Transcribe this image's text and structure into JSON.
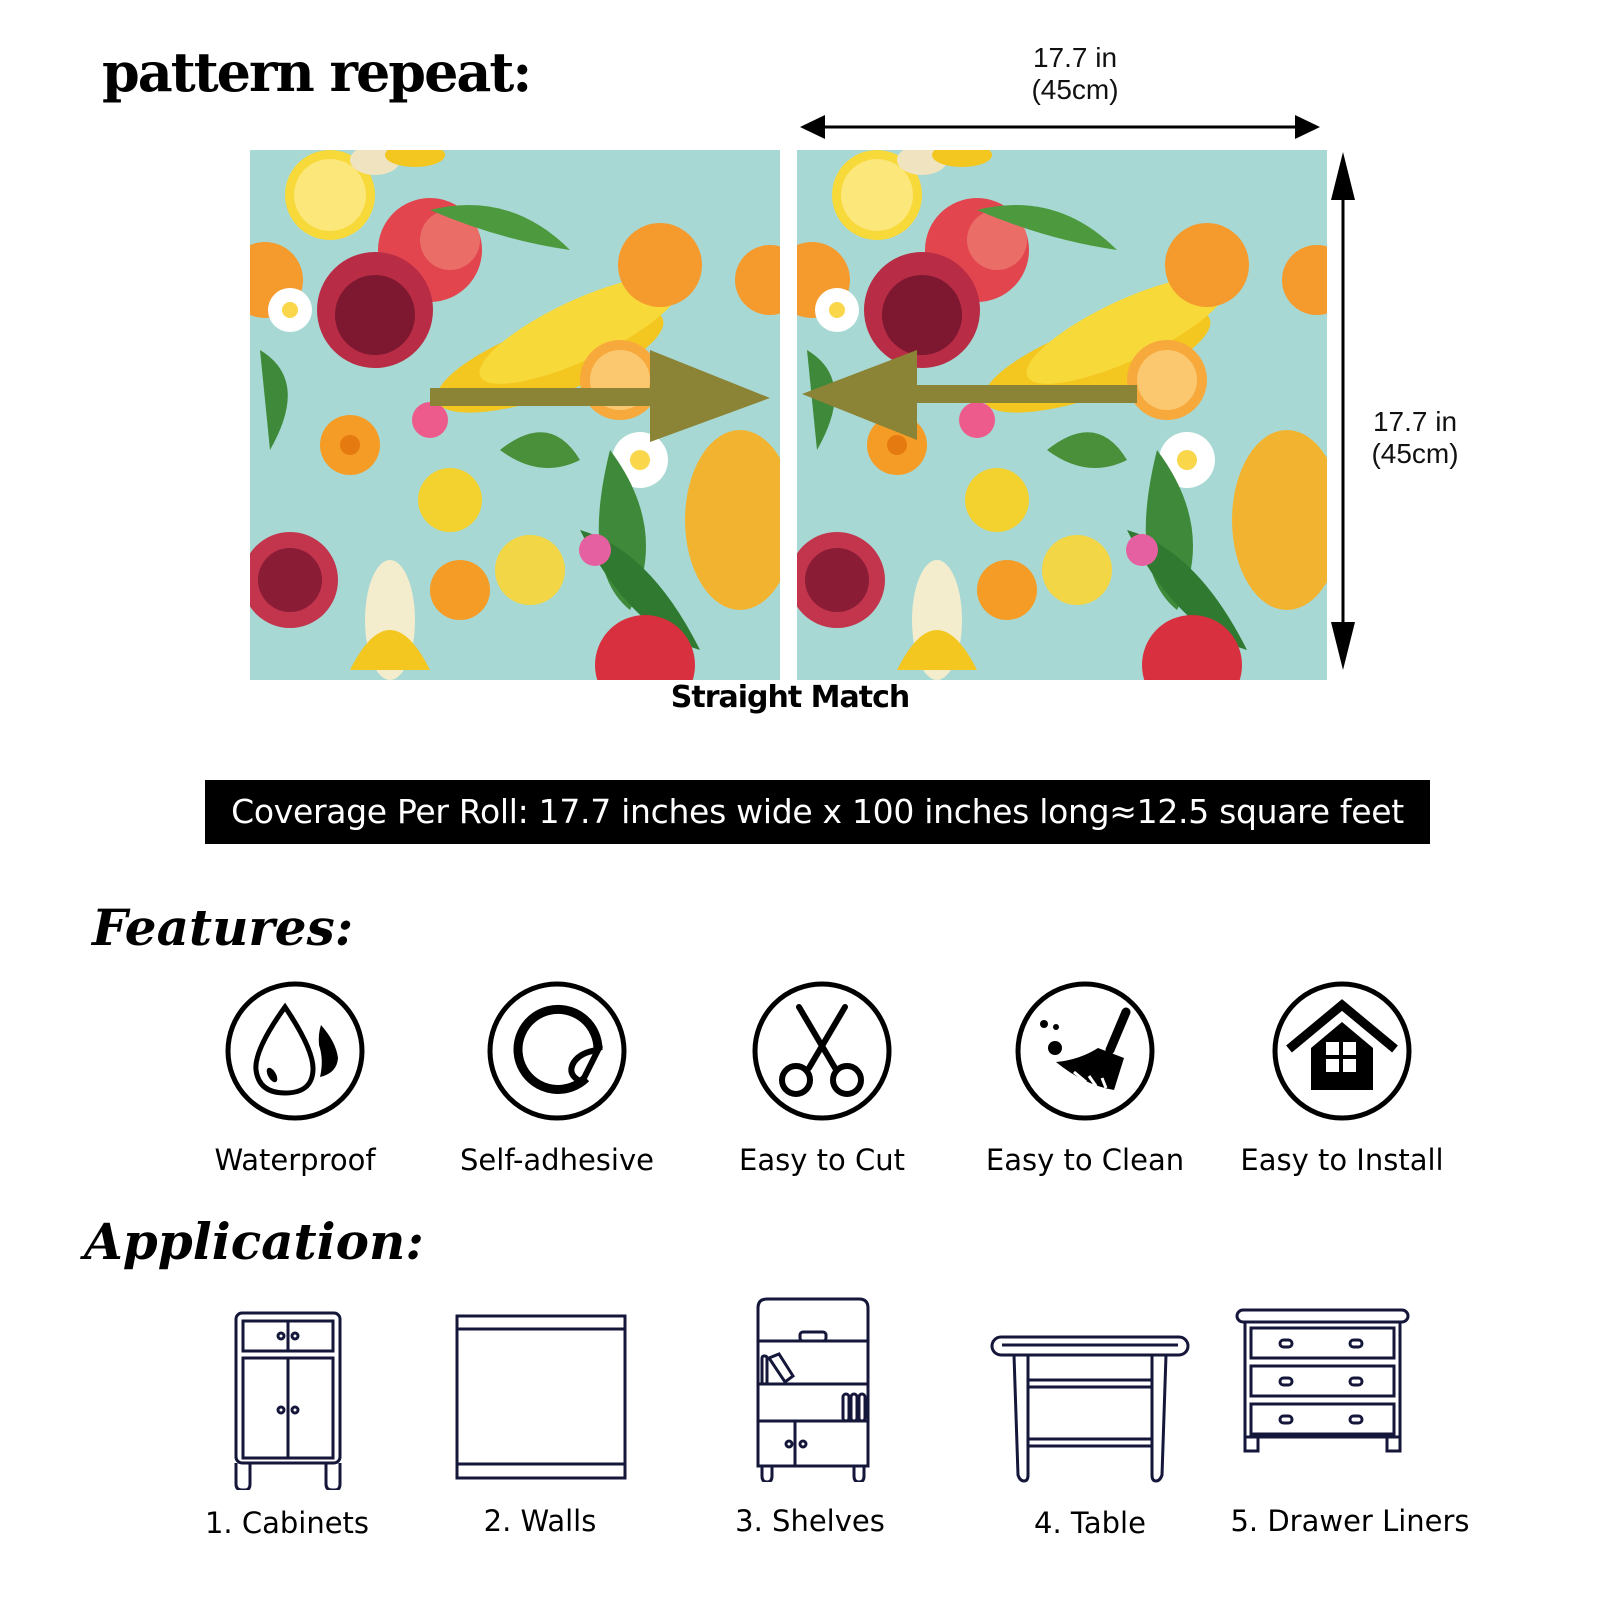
{
  "header": {
    "title": "pattern repeat:"
  },
  "dimensions": {
    "width_in": "17.7 in",
    "width_cm": "(45cm)",
    "height_in": "17.7 in",
    "height_cm": "(45cm)"
  },
  "pattern": {
    "background_color": "#a8d8d3",
    "arrow_color": "#8b8436",
    "match_caption": "Straight Match"
  },
  "coverage": {
    "text": "Coverage Per Roll: 17.7 inches wide x 100 inches long≈12.5 square feet"
  },
  "features": {
    "heading": "Features:",
    "items": [
      {
        "label": "Waterproof",
        "icon": "water-drop-icon"
      },
      {
        "label": "Self-adhesive",
        "icon": "sticker-peel-icon"
      },
      {
        "label": "Easy to Cut",
        "icon": "scissors-icon"
      },
      {
        "label": "Easy to Clean",
        "icon": "broom-icon"
      },
      {
        "label": "Easy to Install",
        "icon": "house-icon"
      }
    ]
  },
  "application": {
    "heading": "Application:",
    "items": [
      {
        "label": "1. Cabinets",
        "icon": "cabinet-icon"
      },
      {
        "label": "2. Walls",
        "icon": "wall-icon"
      },
      {
        "label": "3. Shelves",
        "icon": "shelves-icon"
      },
      {
        "label": "4. Table",
        "icon": "table-icon"
      },
      {
        "label": "5. Drawer Liners",
        "icon": "dresser-icon"
      }
    ]
  }
}
